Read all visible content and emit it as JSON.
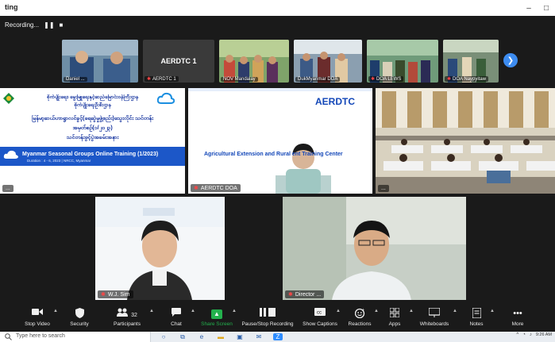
{
  "window": {
    "title": "ting",
    "controls": [
      "–",
      "□"
    ]
  },
  "recording": {
    "label": "Recording...",
    "pause": "❚❚",
    "stop": "■"
  },
  "strip": {
    "tiles": [
      {
        "label": "Daniel ..."
      },
      {
        "label": "AERDTC 1",
        "center": "AERDTC 1"
      },
      {
        "label": "NOV Mandalay"
      },
      {
        "label": "DukMyanmar DOA"
      },
      {
        "label": "DOA LEWS"
      },
      {
        "label": "DOA Naypyitaw"
      }
    ],
    "next_icon": "chevron-right-icon"
  },
  "tiles": {
    "slide": {
      "label": "...",
      "lines": [
        "စိုက်ပျိုးရေး၊ မွေးမြူရေးနှင့်ဆည်မြောင်းဝန်ကြီးဌာန",
        "စိုက်ပျိုးရေးဦးစီးဌာန",
        "မြန်မာ့ဆယ်ဟာရွာလင်ခွင့်(ရေဆွဲမှုဖွဲ့စည်း)သွေးလိုင်း သင်တန်း",
        "အမှတ်စဉ်(၁/၂၀၂၃)",
        "သင်တန်းဖွင့်ပွဲအခမ်းအနား"
      ],
      "band_title": "Myanmar Seasonal Groups Online Training (1/2023)",
      "band_sub": "Duration : 4 - 6, 2023 | NRCC, Myanmar"
    },
    "aerdtc": {
      "label": "AERDTC DOA",
      "brand": "AERDTC",
      "subtitle": "Agricultural Extension and Rural      ent Training Center"
    },
    "room": {
      "label": "..."
    },
    "wj": {
      "label": "W.J. Sim"
    },
    "director": {
      "label": "Director ..."
    }
  },
  "toolbar": [
    {
      "label": "Stop Video",
      "icon": "video-camera-icon"
    },
    {
      "label": "Security",
      "icon": "shield-icon"
    },
    {
      "label": "Participants",
      "icon": "participants-icon",
      "count": "32"
    },
    {
      "label": "Chat",
      "icon": "chat-icon"
    },
    {
      "label": "Share Screen",
      "icon": "share-screen-icon"
    },
    {
      "label": "Pause/Stop Recording",
      "icon": "recording-icon"
    },
    {
      "label": "Show Captions",
      "icon": "captions-icon"
    },
    {
      "label": "Reactions",
      "icon": "reactions-icon"
    },
    {
      "label": "Apps",
      "icon": "apps-icon"
    },
    {
      "label": "Whiteboards",
      "icon": "whiteboard-icon"
    },
    {
      "label": "Notes",
      "icon": "notes-icon"
    },
    {
      "label": "More",
      "icon": "more-icon"
    }
  ],
  "taskbar": {
    "search_placeholder": "Type here to search",
    "time": "9:26 AM"
  },
  "colors": {
    "share_green": "#23b14d",
    "aerdtc_blue": "#1347b8",
    "slide_band": "#1c57c8",
    "muted_mic": "#ff4545"
  }
}
